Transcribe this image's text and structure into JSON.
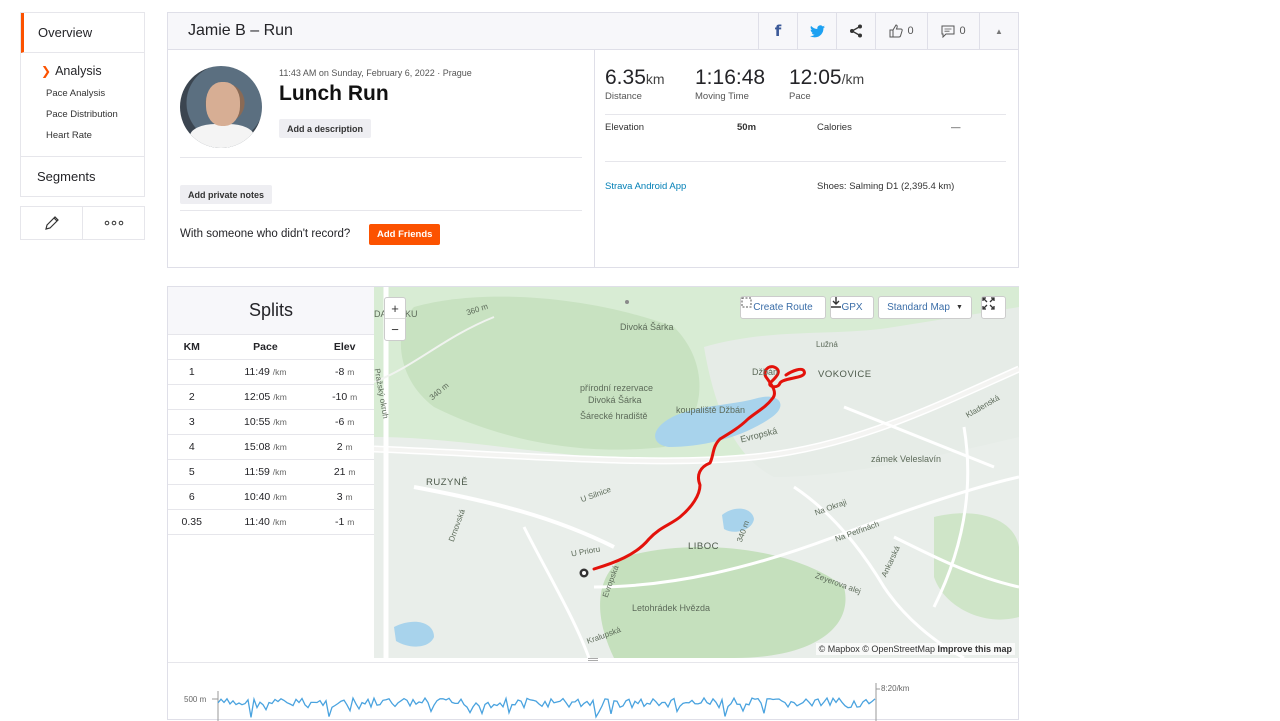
{
  "nav": {
    "overview": "Overview",
    "analysis": "Analysis",
    "links": [
      "Pace Analysis",
      "Pace Distribution",
      "Heart Rate"
    ],
    "segments": "Segments",
    "edit_icon": "pencil-icon",
    "more_icon": "more-icon"
  },
  "header": {
    "title": "Jamie B – Run",
    "kudos_count": "0",
    "comments_count": "0"
  },
  "activity": {
    "meta": "11:43 AM on Sunday, February 6, 2022 · Prague",
    "name": "Lunch Run",
    "add_description": "Add a description",
    "add_private_notes": "Add private notes",
    "with_someone": "With someone who didn't record?",
    "add_friends": "Add Friends"
  },
  "stats": {
    "distance_value": "6.35",
    "distance_unit": "km",
    "distance_label": "Distance",
    "moving_time_value": "1:16:48",
    "moving_time_label": "Moving Time",
    "pace_value": "12:05",
    "pace_unit": "/km",
    "pace_label": "Pace",
    "elevation_label": "Elevation",
    "elevation_value": "50m",
    "calories_label": "Calories",
    "calories_value": "—",
    "device": "Strava Android App",
    "shoes": "Shoes: Salming D1 (2,395.4 km)"
  },
  "splits": {
    "title": "Splits",
    "headers": [
      "KM",
      "Pace",
      "Elev"
    ],
    "rows": [
      {
        "km": "1",
        "pace": "11:49",
        "pace_unit": "/km",
        "elev": "-8",
        "elev_unit": "m"
      },
      {
        "km": "2",
        "pace": "12:05",
        "pace_unit": "/km",
        "elev": "-10",
        "elev_unit": "m"
      },
      {
        "km": "3",
        "pace": "10:55",
        "pace_unit": "/km",
        "elev": "-6",
        "elev_unit": "m"
      },
      {
        "km": "4",
        "pace": "15:08",
        "pace_unit": "/km",
        "elev": "2",
        "elev_unit": "m"
      },
      {
        "km": "5",
        "pace": "11:59",
        "pace_unit": "/km",
        "elev": "21",
        "elev_unit": "m"
      },
      {
        "km": "6",
        "pace": "10:40",
        "pace_unit": "/km",
        "elev": "3",
        "elev_unit": "m"
      },
      {
        "km": "0.35",
        "pace": "11:40",
        "pace_unit": "/km",
        "elev": "-1",
        "elev_unit": "m"
      }
    ]
  },
  "map": {
    "zoom_in": "+",
    "zoom_out": "−",
    "create_route": "Create Route",
    "gpx": "GPX",
    "map_style": "Standard Map",
    "attribution_mapbox": "© Mapbox",
    "attribution_osm": "© OpenStreetMap",
    "improve": "Improve this map",
    "labels": {
      "divoka_sarka": "Divoká Šárka",
      "prirodni": "přírodní rezervace",
      "prirodni2": "Divoká Šárka",
      "sarecke": "Šárecké hradiště",
      "koupaliste": "koupaliště Džbán",
      "dzban": "Džbán",
      "vokovice": "VOKOVICE",
      "luzna": "Lužná",
      "evropska": "Evropská",
      "zamek": "zámek Veleslavín",
      "ruzyne": "RUZYNĚ",
      "u_silnice": "U Silnice",
      "u_prioru": "U Prioru",
      "liboc": "LIBOC",
      "letohradek": "Letohrádek Hvězda",
      "kralupska": "Kralupská",
      "na_okraji": "Na Okraji",
      "na_petrinach": "Na Petřinách",
      "ankarska": "Ankarská",
      "zeyerova": "Zeyerova alej",
      "kladenska": "Kladenská",
      "drnovska": "Drnovská",
      "prazsky": "Pražský okruh",
      "niku": "NÍKU",
      "da": "DA",
      "h360": "360 m",
      "h340": "340 m",
      "h340b": "340 m",
      "evropska2": "Evropská"
    }
  },
  "chart": {
    "left_label": "500 m",
    "right_label": "8:20/km"
  },
  "colors": {
    "accent": "#fc5200",
    "route": "#e3120b",
    "water": "#a8d3ec",
    "chart_line": "#4aa3df"
  }
}
